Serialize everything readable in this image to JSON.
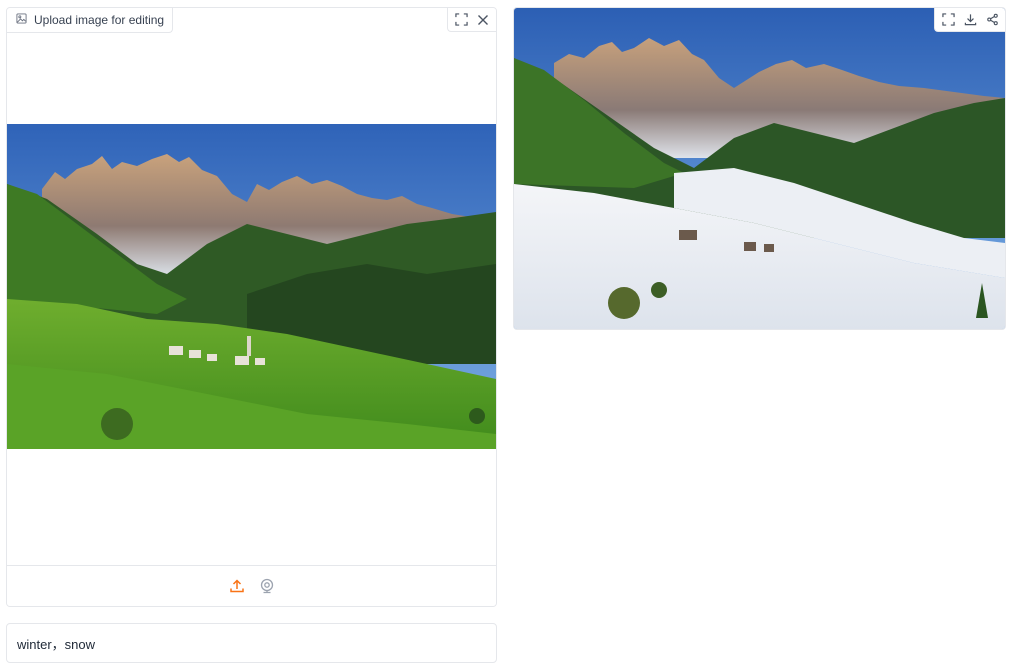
{
  "input_panel": {
    "label": "Upload image for editing",
    "label_icon": "image-icon",
    "actions": [
      "fullscreen-icon",
      "close-icon"
    ],
    "image_alt": "Alpine valley with green meadows and village below jagged rocky peaks",
    "sources": [
      "upload-icon",
      "webcam-icon"
    ]
  },
  "output_panel": {
    "actions": [
      "fullscreen-icon",
      "download-icon",
      "share-icon"
    ],
    "image_alt": "Same alpine valley covered in snow below jagged rocky peaks"
  },
  "prompt": {
    "value": "winter，snow"
  },
  "colors": {
    "accent": "#f97316",
    "border": "#e5e7eb",
    "icon": "#6b7280"
  }
}
